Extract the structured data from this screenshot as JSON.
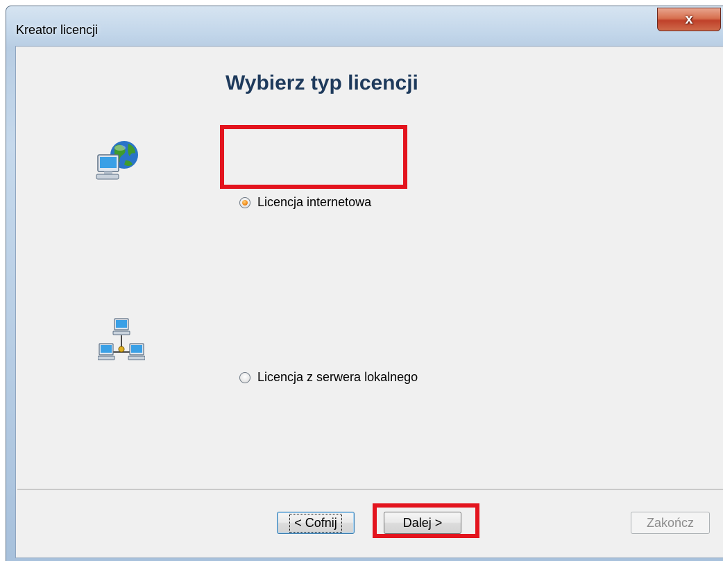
{
  "window": {
    "title": "Kreator licencji"
  },
  "titlebar": {
    "close_glyph": "x"
  },
  "wizard": {
    "heading": "Wybierz typ licencji",
    "options": [
      {
        "label": "Licencja internetowa",
        "checked": true,
        "icon": "internet-network-icon"
      },
      {
        "label": "Licencja z serwera lokalnego",
        "checked": false,
        "icon": "local-network-icon"
      }
    ]
  },
  "buttons": {
    "back": "< Cofnij",
    "next": "Dalej >",
    "finish": "Zakończ"
  },
  "colors": {
    "highlight": "#e3141e",
    "heading": "#1e3a5c",
    "radio_selected": "#f08a18"
  }
}
